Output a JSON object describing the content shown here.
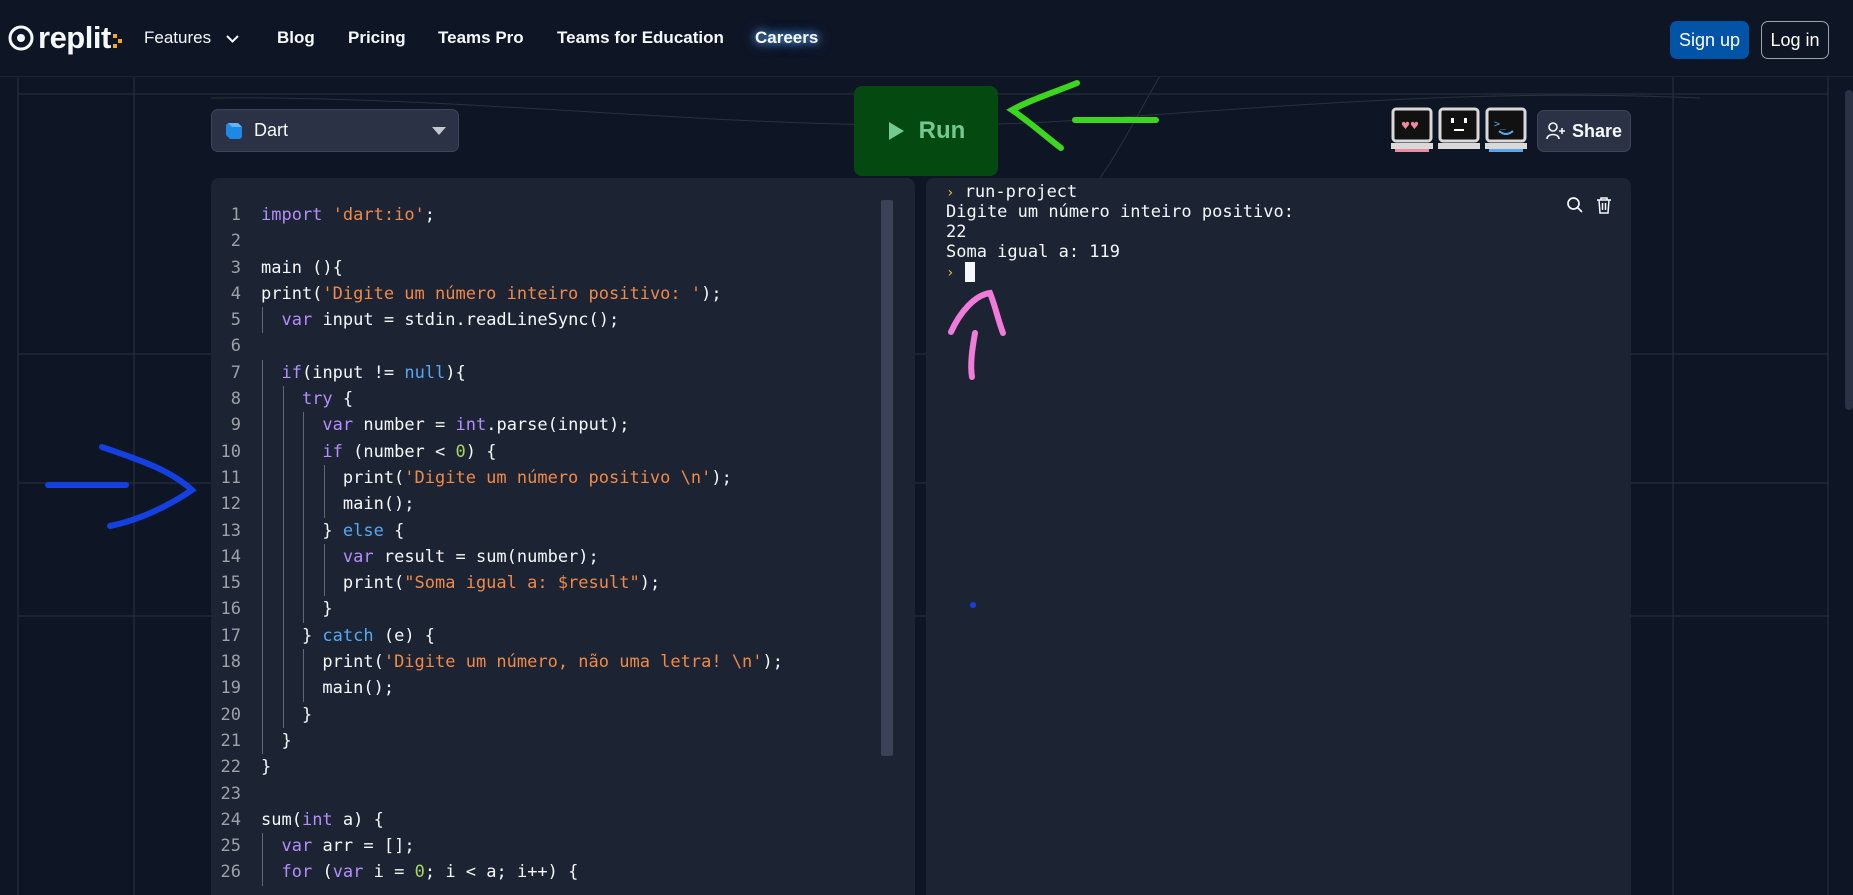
{
  "nav": {
    "logo_text": "replit",
    "items": [
      {
        "label": "Features",
        "dropdown": true
      },
      {
        "label": "Blog"
      },
      {
        "label": "Pricing"
      },
      {
        "label": "Teams Pro"
      },
      {
        "label": "Teams for Education"
      },
      {
        "label": "Careers"
      }
    ],
    "signup_label": "Sign up",
    "login_label": "Log in"
  },
  "toolbar": {
    "language": "Dart",
    "run_label": "Run",
    "share_label": "Share",
    "avatars": [
      "heart-eyes-computer-icon",
      "neutral-face-computer-icon",
      "terminal-face-computer-icon"
    ]
  },
  "editor": {
    "lines": [
      "import 'dart:io';",
      "",
      "main (){",
      "print('Digite um número inteiro positivo: ');",
      "  var input = stdin.readLineSync();",
      "",
      "  if(input != null){",
      "    try {",
      "      var number = int.parse(input);",
      "      if (number < 0) {",
      "        print('Digite um número positivo \\n');",
      "        main();",
      "      } else {",
      "        var result = sum(number);",
      "        print(\"Soma igual a: $result\");",
      "      }",
      "    } catch (e) {",
      "      print('Digite um número, não uma letra! \\n');",
      "      main();",
      "    }",
      "  }",
      "}",
      "",
      "sum(int a) {",
      "  var arr = [];",
      "  for (var i = 0; i < a; i++) {"
    ]
  },
  "console": {
    "command": "run-project",
    "output": [
      "Digite um número inteiro positivo:",
      "22",
      "Soma igual a: 119"
    ],
    "prompt_symbol": "›"
  },
  "colors": {
    "background": "#0e1525",
    "panel": "#1c2333",
    "run_bg": "#044a10",
    "signup_bg": "#0053a6",
    "annotation_green": "#3cd61e",
    "annotation_blue": "#1540e0",
    "annotation_pink": "#f07bd9"
  }
}
